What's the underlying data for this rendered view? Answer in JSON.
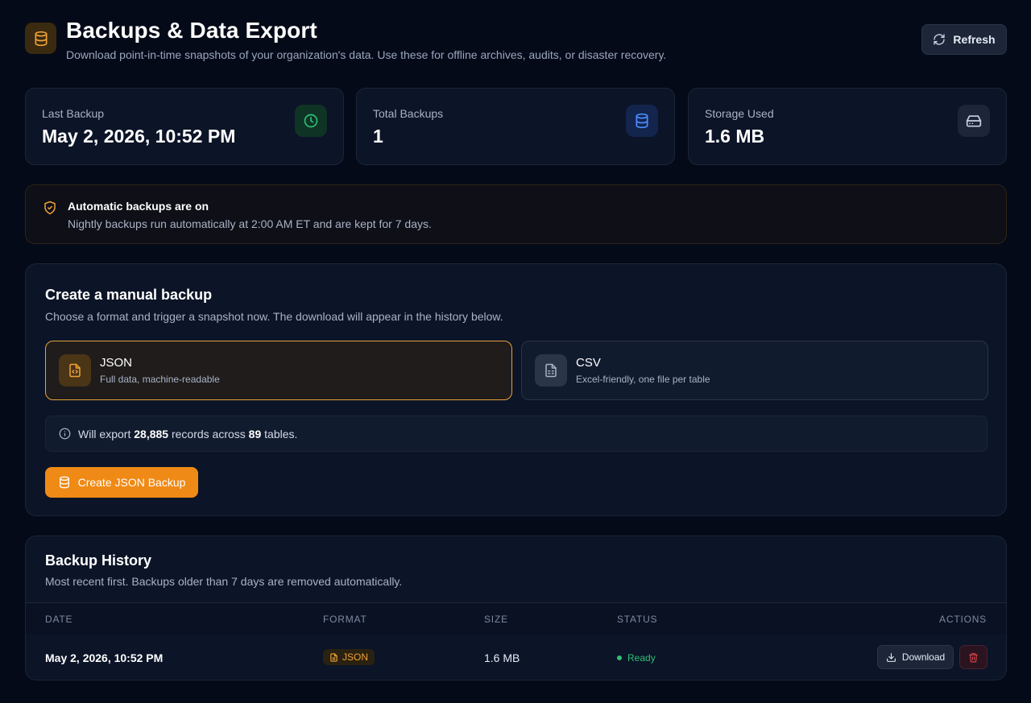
{
  "header": {
    "title": "Backups & Data Export",
    "subtitle": "Download point-in-time snapshots of your organization's data. Use these for offline archives, audits, or disaster recovery.",
    "refresh_label": "Refresh"
  },
  "stats": [
    {
      "label": "Last Backup",
      "value": "May 2, 2026, 10:52 PM",
      "icon": "clock-icon"
    },
    {
      "label": "Total Backups",
      "value": "1",
      "icon": "database-icon"
    },
    {
      "label": "Storage Used",
      "value": "1.6 MB",
      "icon": "hard-drive-icon"
    }
  ],
  "banner": {
    "title": "Automatic backups are on",
    "text": "Nightly backups run automatically at 2:00 AM ET and are kept for 7 days."
  },
  "manual": {
    "title": "Create a manual backup",
    "subtitle": "Choose a format and trigger a snapshot now. The download will appear in the history below.",
    "formats": [
      {
        "name": "JSON",
        "desc": "Full data, machine-readable",
        "selected": true
      },
      {
        "name": "CSV",
        "desc": "Excel-friendly, one file per table",
        "selected": false
      }
    ],
    "info": {
      "prefix": "Will export",
      "records": "28,885",
      "middle": "records across",
      "tables": "89",
      "suffix": "tables."
    },
    "create_label": "Create JSON Backup"
  },
  "history": {
    "title": "Backup History",
    "subtitle": "Most recent first. Backups older than 7 days are removed automatically.",
    "columns": [
      "DATE",
      "FORMAT",
      "SIZE",
      "STATUS",
      "ACTIONS"
    ],
    "rows": [
      {
        "date": "May 2, 2026, 10:52 PM",
        "format": "JSON",
        "size": "1.6 MB",
        "status": "Ready",
        "download_label": "Download"
      }
    ]
  },
  "colors": {
    "accent": "#f08a16",
    "success": "#2fbf77",
    "danger": "#e5484d",
    "background": "#050a18"
  }
}
